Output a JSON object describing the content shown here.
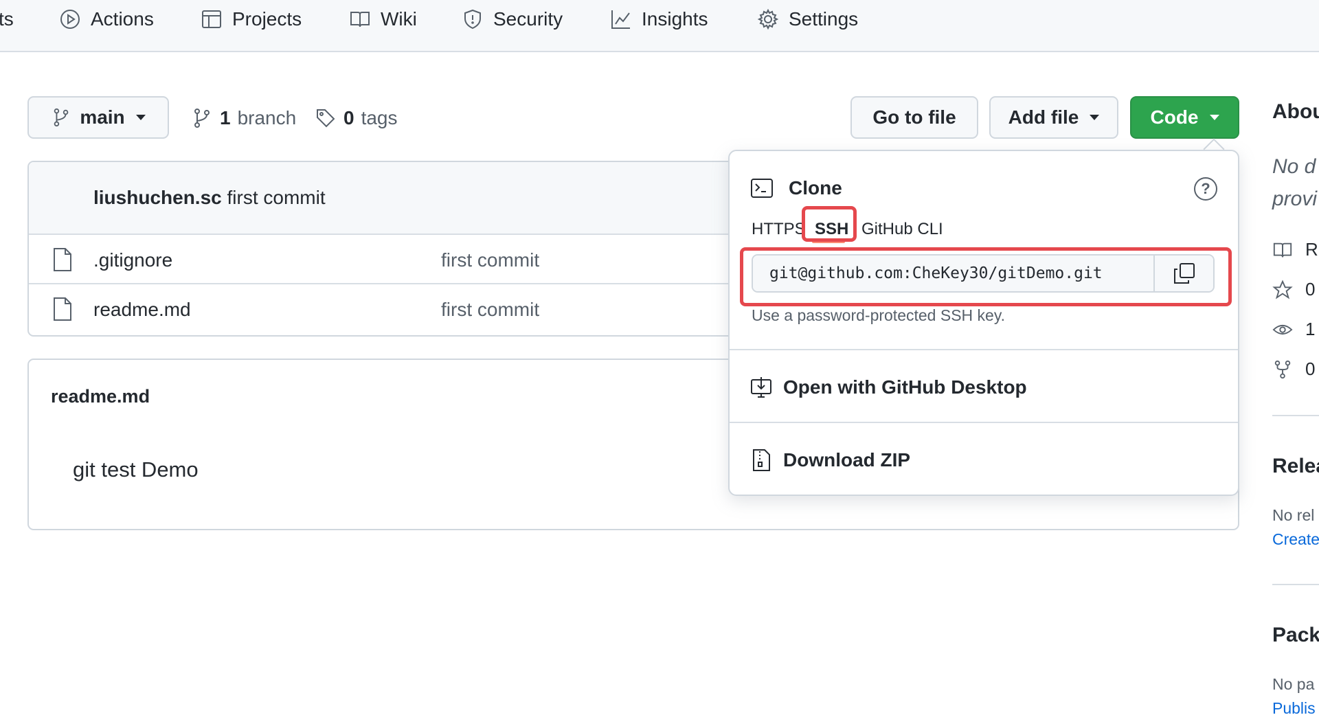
{
  "nav": {
    "partial_tab": "ts",
    "tabs": [
      "Actions",
      "Projects",
      "Wiki",
      "Security",
      "Insights",
      "Settings"
    ]
  },
  "toolbar": {
    "branch_button": "main",
    "branch_count": "1",
    "branch_label": "branch",
    "tag_count": "0",
    "tag_label": "tags",
    "go_to_file": "Go to file",
    "add_file": "Add file",
    "code": "Code"
  },
  "commit": {
    "author": "liushuchen.sc",
    "message": "first commit"
  },
  "files": [
    {
      "name": ".gitignore",
      "message": "first commit"
    },
    {
      "name": "readme.md",
      "message": "first commit"
    }
  ],
  "readme": {
    "title": "readme.md",
    "content": "git test Demo"
  },
  "clone": {
    "title": "Clone",
    "help_symbol": "?",
    "protocols": [
      "HTTPS",
      "SSH",
      "GitHub CLI"
    ],
    "active_protocol": "SSH",
    "url": "git@github.com:CheKey30/gitDemo.git",
    "hint": "Use a password-protected SSH key.",
    "open_desktop": "Open with GitHub Desktop",
    "download_zip": "Download ZIP"
  },
  "sidebar": {
    "about": "Abou",
    "desc_line1": "No d",
    "desc_line2": "provi",
    "readme_short": "R",
    "stars": "0",
    "watchers": "1",
    "forks": "0",
    "releases": "Relea",
    "no_releases": "No rel",
    "create_link": "Create",
    "packages": "Pack",
    "no_packages": "No pa",
    "publish_link": "Publis"
  },
  "colors": {
    "accent_green": "#2da44e",
    "annotation_red": "#e5484d",
    "link_blue": "#0969da"
  }
}
